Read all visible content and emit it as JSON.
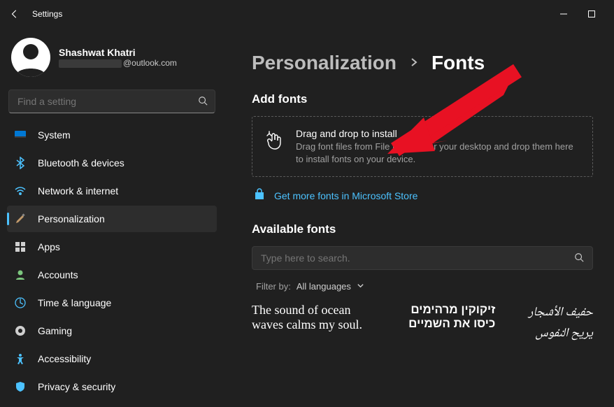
{
  "app_title": "Settings",
  "user": {
    "name": "Shashwat Khatri",
    "email_suffix": "@outlook.com"
  },
  "search": {
    "placeholder": "Find a setting"
  },
  "nav": {
    "system": "System",
    "bluetooth": "Bluetooth & devices",
    "network": "Network & internet",
    "personalization": "Personalization",
    "apps": "Apps",
    "accounts": "Accounts",
    "time": "Time & language",
    "gaming": "Gaming",
    "accessibility": "Accessibility",
    "privacy": "Privacy & security"
  },
  "breadcrumb": {
    "parent": "Personalization",
    "sep": "›",
    "current": "Fonts"
  },
  "add_fonts": {
    "heading": "Add fonts",
    "drop_title": "Drag and drop to install",
    "drop_sub": "Drag font files from File Explorer or your desktop and drop them here to install fonts on your device.",
    "store_link": "Get more fonts in Microsoft Store"
  },
  "available": {
    "heading": "Available fonts",
    "search_placeholder": "Type here to search.",
    "filter_label": "Filter by:",
    "filter_value": "All languages"
  },
  "previews": {
    "p1": "The sound of ocean waves calms my soul.",
    "p2": "זיקוקין מרהימים כיסו את השמיים",
    "p3": "حفيف الأشجار يريح النفوس"
  }
}
